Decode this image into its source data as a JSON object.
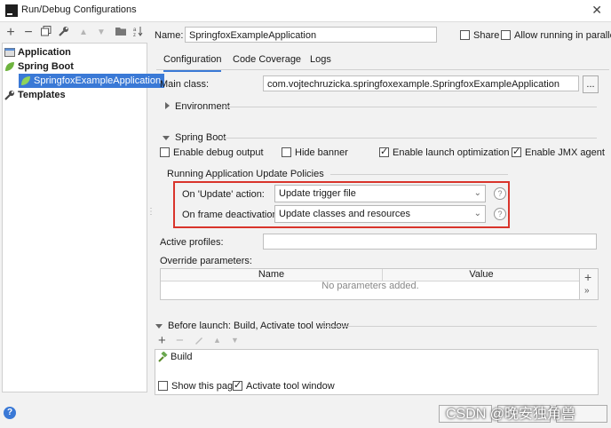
{
  "window": {
    "title": "Run/Debug Configurations"
  },
  "tree": {
    "application": "Application",
    "spring_boot": "Spring Boot",
    "selected_item": "SpringfoxExampleApplication",
    "templates": "Templates"
  },
  "header": {
    "name_label": "Name:",
    "name_value": "SpringfoxExampleApplication",
    "share_label": "Share",
    "parallel_label": "Allow running in parallel"
  },
  "tabs": [
    "Configuration",
    "Code Coverage",
    "Logs"
  ],
  "config": {
    "main_class_label": "Main class:",
    "main_class_value": "com.vojtechruzicka.springfoxexample.SpringfoxExampleApplication",
    "browse_label": "...",
    "environment_label": "Environment",
    "spring_boot_section": "Spring Boot",
    "checkboxes": {
      "debug_output": "Enable debug output",
      "hide_banner": "Hide banner",
      "launch_optimization": "Enable launch optimization",
      "jmx_agent": "Enable JMX agent"
    },
    "policies_title": "Running Application Update Policies",
    "update_action_label": "On 'Update' action:",
    "update_action_value": "Update trigger file",
    "frame_deactivation_label": "On frame deactivation:",
    "frame_deactivation_value": "Update classes and resources",
    "help_glyph": "?",
    "active_profiles_label": "Active profiles:",
    "override_label": "Override parameters:",
    "table": {
      "col_name": "Name",
      "col_value": "Value",
      "empty": "No parameters added."
    }
  },
  "before_launch": {
    "title": "Before launch: Build, Activate tool window",
    "item": "Build",
    "show_page": "Show this page",
    "activate_tool_window": "Activate tool window"
  },
  "footer": {
    "help": "?",
    "watermark": "CSDN @晚安独角兽"
  }
}
